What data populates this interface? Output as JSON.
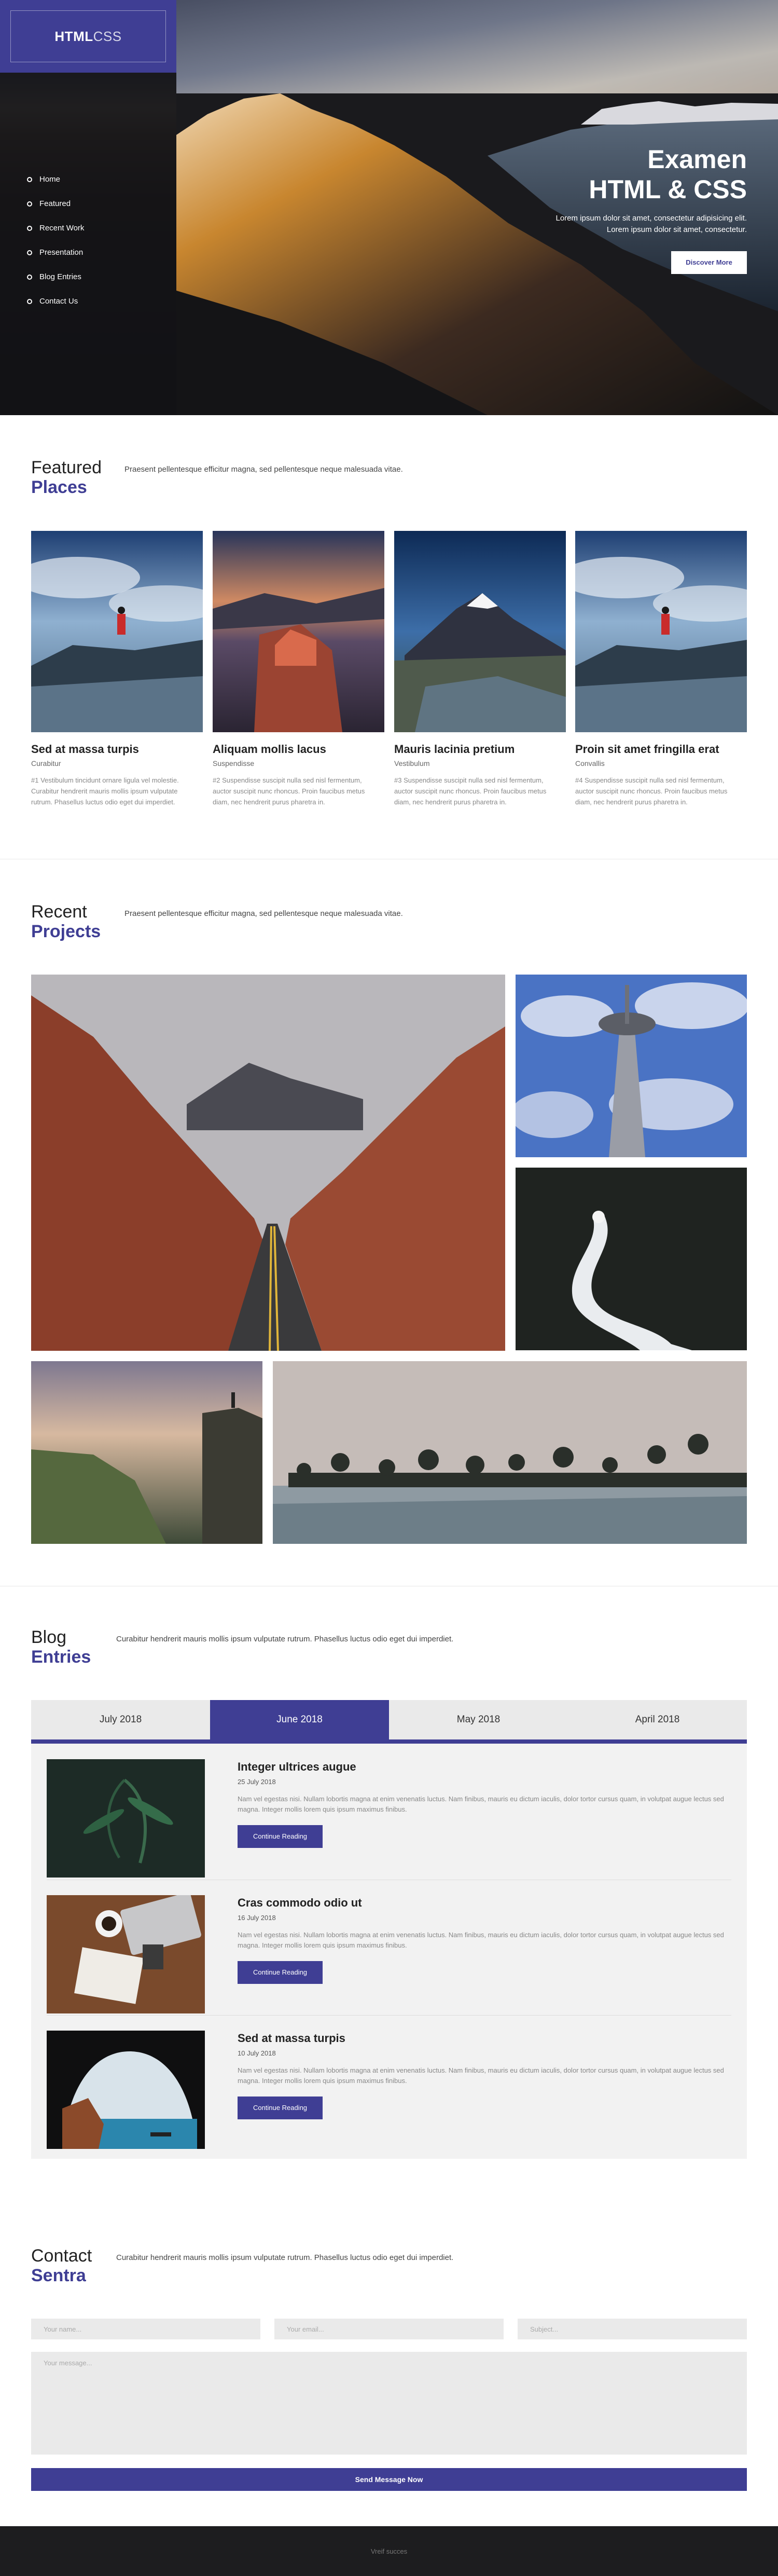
{
  "brand": {
    "bold": "HTML",
    "light": "CSS"
  },
  "nav": [
    "Home",
    "Featured",
    "Recent Work",
    "Presentation",
    "Blog Entries",
    "Contact Us"
  ],
  "hero": {
    "title_line1": "Examen",
    "title_line2": "HTML & CSS",
    "text_line1": "Lorem ipsum dolor sit amet, consectetur adipisicing elit.",
    "text_line2": "Lorem ipsum dolor sit amet, consectetur.",
    "button": "Discover More"
  },
  "featured": {
    "title": "Featured",
    "accent": "Places",
    "description": "Praesent pellentesque efficitur magna, sed pellentesque neque malesuada vitae.",
    "cards": [
      {
        "title": "Sed at massa turpis",
        "subtitle": "Curabitur",
        "text": "#1 Vestibulum tincidunt ornare ligula vel molestie. Curabitur hendrerit mauris mollis ipsum vulputate rutrum. Phasellus luctus odio eget dui imperdiet."
      },
      {
        "title": "Aliquam mollis lacus",
        "subtitle": "Suspendisse",
        "text": "#2 Suspendisse suscipit nulla sed nisl fermentum, auctor suscipit nunc rhoncus. Proin faucibus metus diam, nec hendrerit purus pharetra in."
      },
      {
        "title": "Mauris lacinia pretium",
        "subtitle": "Vestibulum",
        "text": "#3 Suspendisse suscipit nulla sed nisl fermentum, auctor suscipit nunc rhoncus. Proin faucibus metus diam, nec hendrerit purus pharetra in."
      },
      {
        "title": "Proin sit amet fringilla erat",
        "subtitle": "Convallis",
        "text": "#4 Suspendisse suscipit nulla sed nisl fermentum, auctor suscipit nunc rhoncus. Proin faucibus metus diam, nec hendrerit purus pharetra in."
      }
    ]
  },
  "projects": {
    "title": "Recent",
    "accent": "Projects",
    "description": "Praesent pellentesque efficitur magna, sed pellentesque neque malesuada vitae."
  },
  "blog": {
    "title": "Blog",
    "accent": "Entries",
    "description": "Curabitur hendrerit mauris mollis ipsum vulputate rutrum. Phasellus luctus odio eget dui imperdiet.",
    "tabs": [
      "July 2018",
      "June 2018",
      "May 2018",
      "April 2018"
    ],
    "active_tab": 1,
    "posts": [
      {
        "title": "Integer ultrices augue",
        "date": "25 July 2018",
        "text": "Nam vel egestas nisi. Nullam lobortis magna at enim venenatis luctus. Nam finibus, mauris eu dictum iaculis, dolor tortor cursus quam, in volutpat augue lectus sed magna. Integer mollis lorem quis ipsum maximus finibus.",
        "button": "Continue Reading"
      },
      {
        "title": "Cras commodo odio ut",
        "date": "16 July 2018",
        "text": "Nam vel egestas nisi. Nullam lobortis magna at enim venenatis luctus. Nam finibus, mauris eu dictum iaculis, dolor tortor cursus quam, in volutpat augue lectus sed magna. Integer mollis lorem quis ipsum maximus finibus.",
        "button": "Continue Reading"
      },
      {
        "title": "Sed at massa turpis",
        "date": "10 July 2018",
        "text": "Nam vel egestas nisi. Nullam lobortis magna at enim venenatis luctus. Nam finibus, mauris eu dictum iaculis, dolor tortor cursus quam, in volutpat augue lectus sed magna. Integer mollis lorem quis ipsum maximus finibus.",
        "button": "Continue Reading"
      }
    ]
  },
  "contact": {
    "title": "Contact",
    "accent": "Sentra",
    "description": "Curabitur hendrerit mauris mollis ipsum vulputate rutrum. Phasellus luctus odio eget dui imperdiet.",
    "name_placeholder": "Your name...",
    "email_placeholder": "Your email...",
    "subject_placeholder": "Subject...",
    "message_placeholder": "Your message...",
    "button": "Send Message Now"
  },
  "footer": "Vreif succes",
  "colors": {
    "accent": "#3f3e94",
    "sidebar": "#121216",
    "panel": "#f2f2f2",
    "footer": "#1d1d1f"
  }
}
